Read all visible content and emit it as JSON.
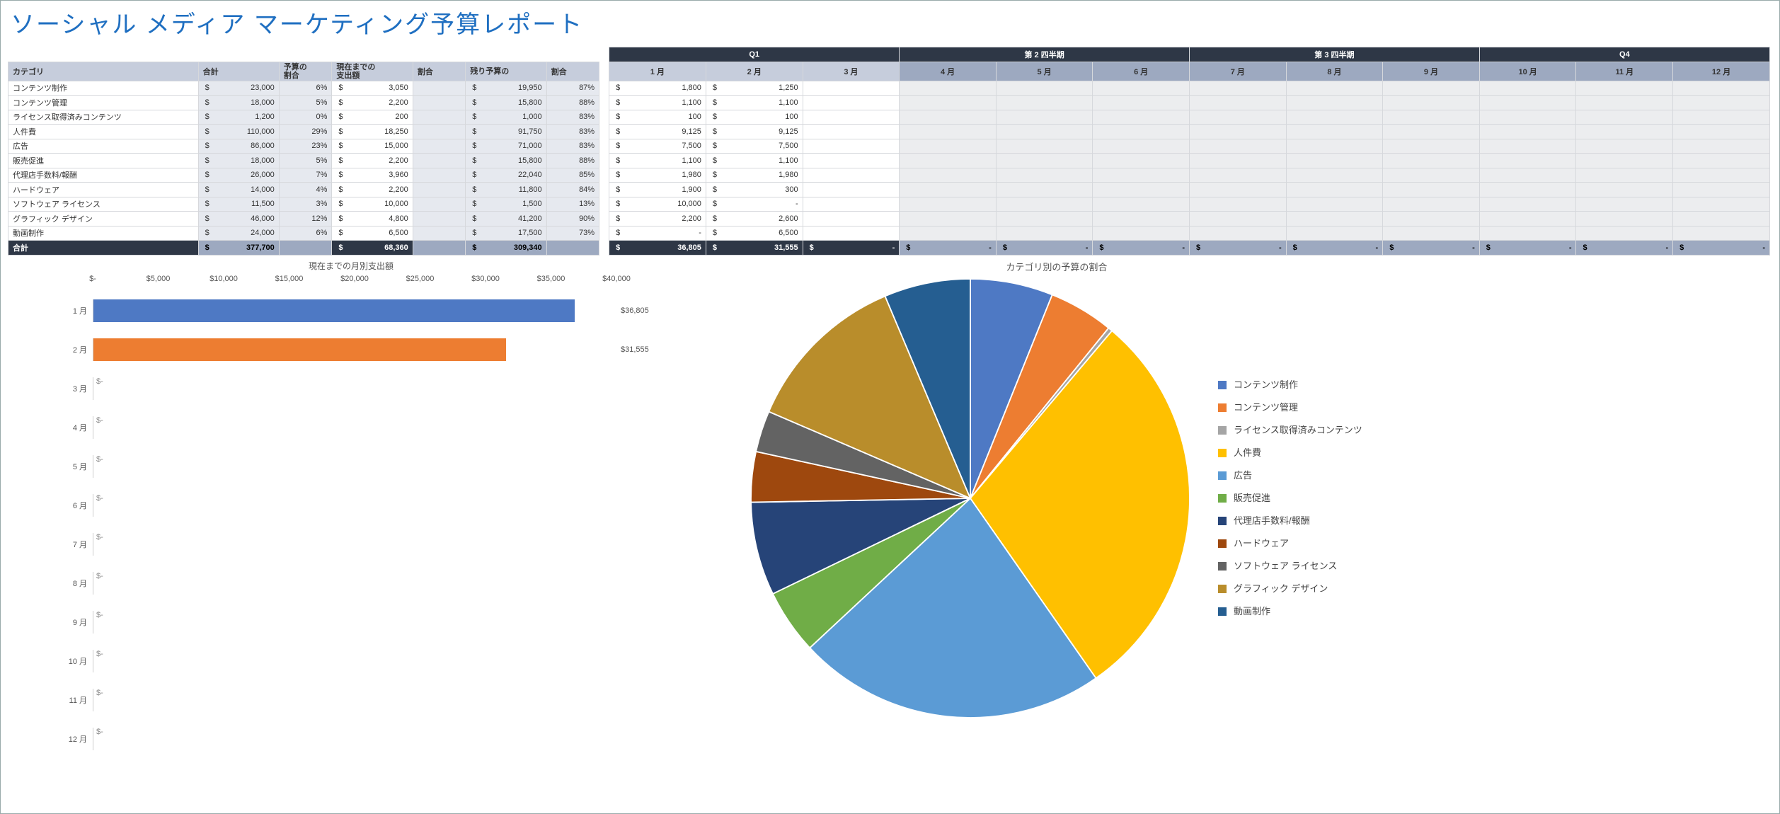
{
  "title": "ソーシャル メディア マーケティング予算レポート",
  "headers": {
    "category": "カテゴリ",
    "total": "合計",
    "percent_of_budget_l1": "予算の",
    "percent_of_budget_l2": "割合",
    "spent_to_date_l1": "現在までの",
    "spent_to_date_l2": "支出額",
    "percent": "割合",
    "remaining_l1": "残り予算の",
    "remaining_l2": "割合",
    "quarters": [
      "Q1",
      "第 2 四半期",
      "第 3 四半期",
      "Q4"
    ],
    "months": [
      "1 月",
      "2 月",
      "3 月",
      "4 月",
      "5 月",
      "6 月",
      "7 月",
      "8 月",
      "9 月",
      "10 月",
      "11 月",
      "12 月"
    ]
  },
  "rows": [
    {
      "cat": "コンテンツ制作",
      "total": "23,000",
      "pbud": "6%",
      "spent": "3,050",
      "pct": "",
      "remain": "19,950",
      "rpct": "87%",
      "m": [
        "1,800",
        "1,250",
        "",
        "",
        "",
        "",
        "",
        "",
        "",
        "",
        "",
        ""
      ]
    },
    {
      "cat": "コンテンツ管理",
      "total": "18,000",
      "pbud": "5%",
      "spent": "2,200",
      "pct": "",
      "remain": "15,800",
      "rpct": "88%",
      "m": [
        "1,100",
        "1,100",
        "",
        "",
        "",
        "",
        "",
        "",
        "",
        "",
        "",
        ""
      ]
    },
    {
      "cat": "ライセンス取得済みコンテンツ",
      "total": "1,200",
      "pbud": "0%",
      "spent": "200",
      "pct": "",
      "remain": "1,000",
      "rpct": "83%",
      "m": [
        "100",
        "100",
        "",
        "",
        "",
        "",
        "",
        "",
        "",
        "",
        "",
        ""
      ]
    },
    {
      "cat": "人件費",
      "total": "110,000",
      "pbud": "29%",
      "spent": "18,250",
      "pct": "",
      "remain": "91,750",
      "rpct": "83%",
      "m": [
        "9,125",
        "9,125",
        "",
        "",
        "",
        "",
        "",
        "",
        "",
        "",
        "",
        ""
      ]
    },
    {
      "cat": "広告",
      "total": "86,000",
      "pbud": "23%",
      "spent": "15,000",
      "pct": "",
      "remain": "71,000",
      "rpct": "83%",
      "m": [
        "7,500",
        "7,500",
        "",
        "",
        "",
        "",
        "",
        "",
        "",
        "",
        "",
        ""
      ]
    },
    {
      "cat": "販売促進",
      "total": "18,000",
      "pbud": "5%",
      "spent": "2,200",
      "pct": "",
      "remain": "15,800",
      "rpct": "88%",
      "m": [
        "1,100",
        "1,100",
        "",
        "",
        "",
        "",
        "",
        "",
        "",
        "",
        "",
        ""
      ]
    },
    {
      "cat": "代理店手数料/報酬",
      "total": "26,000",
      "pbud": "7%",
      "spent": "3,960",
      "pct": "",
      "remain": "22,040",
      "rpct": "85%",
      "m": [
        "1,980",
        "1,980",
        "",
        "",
        "",
        "",
        "",
        "",
        "",
        "",
        "",
        ""
      ]
    },
    {
      "cat": "ハードウェア",
      "total": "14,000",
      "pbud": "4%",
      "spent": "2,200",
      "pct": "",
      "remain": "11,800",
      "rpct": "84%",
      "m": [
        "1,900",
        "300",
        "",
        "",
        "",
        "",
        "",
        "",
        "",
        "",
        "",
        ""
      ]
    },
    {
      "cat": "ソフトウェア ライセンス",
      "total": "11,500",
      "pbud": "3%",
      "spent": "10,000",
      "pct": "",
      "remain": "1,500",
      "rpct": "13%",
      "m": [
        "10,000",
        "-",
        "",
        "",
        "",
        "",
        "",
        "",
        "",
        "",
        "",
        ""
      ]
    },
    {
      "cat": "グラフィック デザイン",
      "total": "46,000",
      "pbud": "12%",
      "spent": "4,800",
      "pct": "",
      "remain": "41,200",
      "rpct": "90%",
      "m": [
        "2,200",
        "2,600",
        "",
        "",
        "",
        "",
        "",
        "",
        "",
        "",
        "",
        ""
      ]
    },
    {
      "cat": "動画制作",
      "total": "24,000",
      "pbud": "6%",
      "spent": "6,500",
      "pct": "",
      "remain": "17,500",
      "rpct": "73%",
      "m": [
        "-",
        "6,500",
        "",
        "",
        "",
        "",
        "",
        "",
        "",
        "",
        "",
        ""
      ]
    }
  ],
  "total_row": {
    "label": "合計",
    "total": "377,700",
    "spent": "68,360",
    "remain": "309,340",
    "months": [
      "36,805",
      "31,555",
      "-",
      "-",
      "-",
      "-",
      "-",
      "-",
      "-",
      "-",
      "-",
      "-"
    ]
  },
  "chart_data": [
    {
      "type": "bar",
      "orientation": "horizontal",
      "title": "現在までの月別支出額",
      "xlabel": "",
      "ylabel": "",
      "xlim": [
        0,
        40000
      ],
      "x_ticks": [
        "$-",
        "$5,000",
        "$10,000",
        "$15,000",
        "$20,000",
        "$25,000",
        "$30,000",
        "$35,000",
        "$40,000"
      ],
      "categories": [
        "1 月",
        "2 月",
        "3 月",
        "4 月",
        "5 月",
        "6 月",
        "7 月",
        "8 月",
        "9 月",
        "10 月",
        "11 月",
        "12 月"
      ],
      "values": [
        36805,
        31555,
        0,
        0,
        0,
        0,
        0,
        0,
        0,
        0,
        0,
        0
      ],
      "value_labels": [
        "$36,805",
        "$31,555",
        "$-",
        "$-",
        "$-",
        "$-",
        "$-",
        "$-",
        "$-",
        "$-",
        "$-",
        "$-"
      ],
      "colors": [
        "#4e79c4",
        "#ed7d31"
      ]
    },
    {
      "type": "pie",
      "title": "カテゴリ別の予算の割合",
      "series": [
        {
          "name": "コンテンツ制作",
          "value": 23000,
          "color": "#4e79c4"
        },
        {
          "name": "コンテンツ管理",
          "value": 18000,
          "color": "#ed7d31"
        },
        {
          "name": "ライセンス取得済みコンテンツ",
          "value": 1200,
          "color": "#a5a5a5"
        },
        {
          "name": "人件費",
          "value": 110000,
          "color": "#ffc000"
        },
        {
          "name": "広告",
          "value": 86000,
          "color": "#5b9bd5"
        },
        {
          "name": "販売促進",
          "value": 18000,
          "color": "#70ad47"
        },
        {
          "name": "代理店手数料/報酬",
          "value": 26000,
          "color": "#264478"
        },
        {
          "name": "ハードウェア",
          "value": 14000,
          "color": "#9e480e"
        },
        {
          "name": "ソフトウェア ライセンス",
          "value": 11500,
          "color": "#636363"
        },
        {
          "name": "グラフィック デザイン",
          "value": 46000,
          "color": "#b98d2b"
        },
        {
          "name": "動画制作",
          "value": 24000,
          "color": "#255e91"
        }
      ]
    }
  ]
}
